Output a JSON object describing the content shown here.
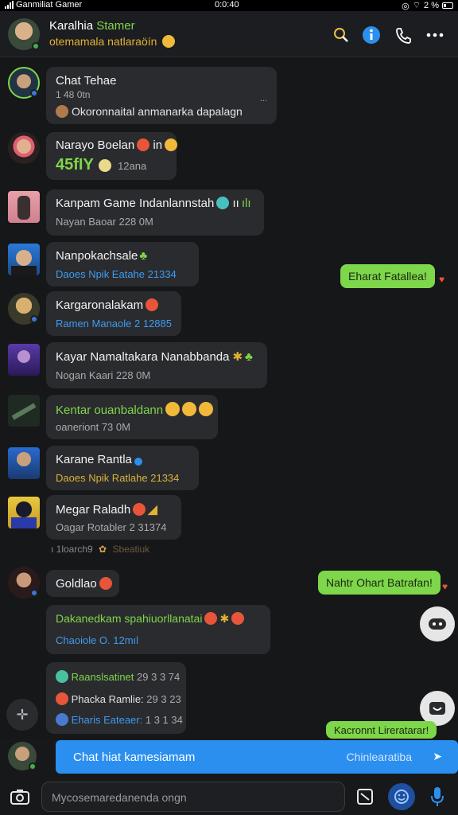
{
  "status_bar": {
    "carrier": "Ganmiliat Gamer",
    "time": "0:0:40",
    "battery_text": "2 %"
  },
  "header": {
    "title_main": "Karalhia",
    "title_accent": "Stamer",
    "subtitle": "otemamala natlaraöín",
    "icons": [
      "search-icon",
      "info-icon",
      "phone-icon",
      "more-icon"
    ]
  },
  "messages": [
    {
      "name": "Chat Tehae",
      "sub1": "1 48 0tn",
      "sub2": "Okoronnaital anmanarka dapalagn",
      "preview_marker": "..."
    },
    {
      "name": "Narayo Boelan",
      "name_suffix": "in",
      "sub_big": "45fIY",
      "sub_time": "12ana"
    },
    {
      "name": "Kanpam Game Indanlannstah",
      "name_suffix": "ıı",
      "sub": "Nayan Baoar 228 0M"
    },
    {
      "name": "Nanpokachsale",
      "sub": "Daoes Npik Eatahe 21334"
    },
    {
      "name": "Kargaronalakam",
      "sub": "Ramen Manaole 2 12885"
    },
    {
      "name": "Kayar Namaltakara Nanabbanda",
      "sub": "Nogan Kaari 228 0M"
    },
    {
      "name": "Kentar ouanbaldann",
      "sub": "oaneriont 73 0M"
    },
    {
      "name": "Karane Rantla",
      "sub": "Daoes Npik Ratlahe 21334"
    },
    {
      "name": "Megar Raladh",
      "sub": "Oagar Rotabler 2 31374"
    }
  ],
  "date_divider": {
    "left": "ı 1loarch9",
    "right": "Sbeatiuk"
  },
  "own_messages": [
    {
      "text": "Eharat Fatallea!"
    },
    {
      "text": "Nahtr Ohart Batrafan!"
    },
    {
      "text": "Kacronnt Lireratarar!"
    }
  ],
  "goldlao": {
    "name": "Goldlao"
  },
  "long_message": {
    "name": "Dakanedkam spahiuorllanatai",
    "sub": "Chaoiole O. 12mıl"
  },
  "list_message": {
    "items": [
      {
        "label": "Raanslsatinet",
        "value": "29 3 3 74"
      },
      {
        "label": "Phacka Ramlie:",
        "value": "29 3 23"
      },
      {
        "label": "Eharis Eateaer:",
        "value": "1 3 1 34"
      }
    ]
  },
  "compose": {
    "placeholder": "Chat hiat kamesiamam",
    "hint": "Chinlearatiba"
  },
  "bottom_bar": {
    "input_placeholder": "Mycosemaredanenda ongn"
  },
  "colors": {
    "accent_green": "#7ed64a",
    "accent_blue": "#2b8ff0",
    "accent_yellow": "#e2b233",
    "background": "#161719",
    "bubble": "#2a2b2e"
  }
}
